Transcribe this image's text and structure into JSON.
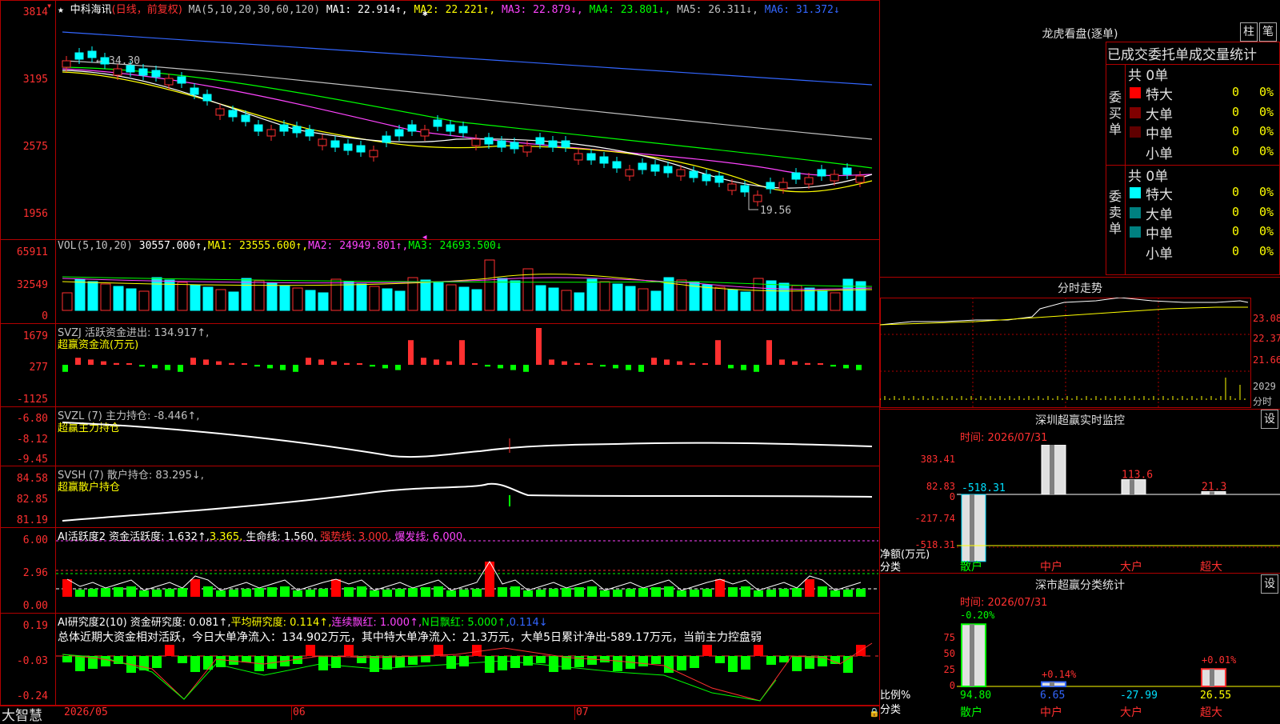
{
  "main_chart": {
    "stock_name": "中科海讯",
    "period": "(日线，前复权)",
    "ma_label": "MA(5,10,20,30,60,120)",
    "ma": [
      {
        "label": "MA1:",
        "value": "22.914↑",
        "color": "#ffffff"
      },
      {
        "label": "MA2:",
        "value": "22.221↑",
        "color": "#ffff00"
      },
      {
        "label": "MA3:",
        "value": "22.879↓",
        "color": "#ff44ff"
      },
      {
        "label": "MA4:",
        "value": "23.801↓",
        "color": "#00ff00"
      },
      {
        "label": "MA5:",
        "value": "26.311↓",
        "color": "#c0c0c0"
      },
      {
        "label": "MA6:",
        "value": "31.372↓",
        "color": "#3366ff"
      }
    ],
    "y_ticks": [
      "3814",
      "3195",
      "2575",
      "1956"
    ],
    "high_label": "34.30",
    "low_label": "19.56"
  },
  "vol": {
    "header": "VOL(5,10,20)",
    "value": "30557.000↑,",
    "ma1": "MA1: 23555.600↑,",
    "ma2": "MA2: 24949.801↑,",
    "ma3": "MA3: 24693.500↓",
    "y_ticks": [
      "65911",
      "32549",
      "0"
    ]
  },
  "svzj": {
    "header": "SVZJ  活跃资金进出: 134.917↑,",
    "sub": "超赢资金流(万元)",
    "y_ticks": [
      "1679",
      "277",
      "-1125"
    ]
  },
  "svzl": {
    "header": "SVZL (7) 主力持仓: -8.446↑,",
    "sub": "超赢主力持仓",
    "y_ticks": [
      "-6.80",
      "-8.12",
      "-9.45"
    ]
  },
  "svsh": {
    "header": "SVSH (7) 散户持仓: 83.295↓,",
    "sub": "超赢散户持仓",
    "y_ticks": [
      "84.58",
      "82.85",
      "81.19"
    ]
  },
  "ai1": {
    "header": "AI活跃度2 资金活跃度: 1.632↑,",
    "v2": "3.365,",
    "life": "生命线: 1.560,",
    "strong": "强势线: 3.000,",
    "burst": "爆发线: 6.000,",
    "y_ticks": [
      "6.00",
      "2.96",
      "0.00"
    ]
  },
  "ai2": {
    "header": "AI研究度2(10) 资金研究度: 0.081↑,",
    "avg": "平均研究度: 0.114↑,",
    "cont": "连续飘红: 1.000↑,",
    "nday": "N日飘红: 5.000↑,",
    "last": "0.114↓",
    "summary": "总体近期大资金相对活跃，今日大单净流入：134.902万元，其中特大单净流入：21.3万元，大单5日累计净出-589.17万元，当前主力控盘弱",
    "y_ticks": [
      "0.19",
      "-0.03",
      "-0.24"
    ]
  },
  "footer": {
    "brand": "大智慧",
    "dates": [
      "2026/05",
      "06",
      "07"
    ]
  },
  "right_panel": {
    "longhu_title": "龙虎看盘(逐单)",
    "btn_bar": "柱",
    "btn_pen": "笔",
    "stat_title": "已成交委托单成交量统计",
    "buy_side": "委买单",
    "sell_side": "委卖单",
    "buy_total": "共 0单",
    "sell_total": "共 0单",
    "buy_rows": [
      {
        "label": "特大",
        "count": "0",
        "pct": "0%",
        "color": "#ff0000"
      },
      {
        "label": "大单",
        "count": "0",
        "pct": "0%",
        "color": "#800000"
      },
      {
        "label": "中单",
        "count": "0",
        "pct": "0%",
        "color": "#600000"
      },
      {
        "label": "小单",
        "count": "0",
        "pct": "0%",
        "color": ""
      }
    ],
    "sell_rows": [
      {
        "label": "特大",
        "count": "0",
        "pct": "0%",
        "color": "#00ffff"
      },
      {
        "label": "大单",
        "count": "0",
        "pct": "0%",
        "color": "#008080"
      },
      {
        "label": "中单",
        "count": "0",
        "pct": "0%",
        "color": "#008080"
      },
      {
        "label": "小单",
        "count": "0",
        "pct": "0%",
        "color": ""
      }
    ],
    "intraday_title": "分时走势",
    "intraday_ticks": [
      "23.08",
      "22.37",
      "21.66",
      "2029",
      "分时"
    ],
    "monitor_title": "深圳超赢实时监控",
    "monitor_btn": "设",
    "monitor_time": "时间: 2026/07/31",
    "monitor_ticks": [
      "383.41",
      "82.83",
      "0",
      "-217.74",
      "-518.31"
    ],
    "monitor_values": [
      "-518.31",
      "383.41",
      "113.6",
      "21.3"
    ],
    "monitor_ylabel": "净额(万元)",
    "monitor_xlabel": "分类",
    "categories": [
      "散户",
      "中户",
      "大户",
      "超大"
    ],
    "class_title": "深市超赢分类统计",
    "class_btn": "设",
    "class_time": "时间: 2026/07/31",
    "class_ticks": [
      "75",
      "50",
      "25",
      "0"
    ],
    "class_top": [
      "-0.20%",
      "+0.14%",
      "+0.01%"
    ],
    "class_bottom": [
      "94.80",
      "6.65",
      "-27.99",
      "26.55"
    ],
    "class_ylabel": "比例%",
    "class_xlabel": "分类"
  }
}
